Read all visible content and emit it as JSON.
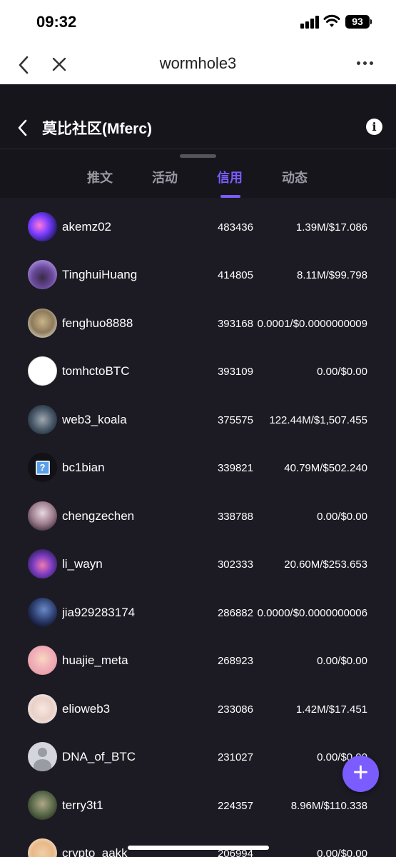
{
  "status_bar": {
    "time": "09:32",
    "battery": "93"
  },
  "browser": {
    "title": "wormhole3"
  },
  "app_header": {
    "title": "莫比社区(Mferc)"
  },
  "tabs": [
    {
      "label": "推文"
    },
    {
      "label": "活动"
    },
    {
      "label": "信用"
    },
    {
      "label": "动态"
    }
  ],
  "active_tab": "信用",
  "accent_color": "#7b5cff",
  "leaderboard": [
    {
      "username": "akemz02",
      "score": "483436",
      "value": "1.39M/$17.086"
    },
    {
      "username": "TinghuiHuang",
      "score": "414805",
      "value": "8.11M/$99.798"
    },
    {
      "username": "fenghuo8888",
      "score": "393168",
      "value": "0.0001/$0.0000000009"
    },
    {
      "username": "tomhctoBTC",
      "score": "393109",
      "value": "0.00/$0.00"
    },
    {
      "username": "web3_koala",
      "score": "375575",
      "value": "122.44M/$1,507.455"
    },
    {
      "username": "bc1bian",
      "score": "339821",
      "value": "40.79M/$502.240"
    },
    {
      "username": "chengzechen",
      "score": "338788",
      "value": "0.00/$0.00"
    },
    {
      "username": "li_wayn",
      "score": "302333",
      "value": "20.60M/$253.653"
    },
    {
      "username": "jia929283174",
      "score": "286882",
      "value": "0.0000/$0.0000000006"
    },
    {
      "username": "huajie_meta",
      "score": "268923",
      "value": "0.00/$0.00"
    },
    {
      "username": "elioweb3",
      "score": "233086",
      "value": "1.42M/$17.451"
    },
    {
      "username": "DNA_of_BTC",
      "score": "231027",
      "value": "0.00/$0.00"
    },
    {
      "username": "terry3t1",
      "score": "224357",
      "value": "8.96M/$110.338"
    },
    {
      "username": "crypto_aakk",
      "score": "206994",
      "value": "0.00/$0.00"
    }
  ]
}
